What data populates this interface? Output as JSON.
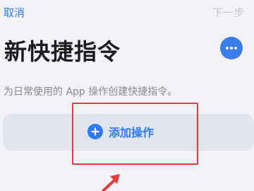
{
  "nav": {
    "cancel_label": "取消",
    "next_label": "下一步"
  },
  "header": {
    "title": "新快捷指令",
    "more_icon": "ellipsis-icon"
  },
  "description": "为日常使用的 App 操作创建快捷指令。",
  "action_card": {
    "add_label": "添加操作",
    "add_icon": "plus-circle-icon"
  },
  "annotation": {
    "highlight_color": "#e43c3c",
    "arrow_icon": "arrow-icon"
  },
  "colors": {
    "accent": "#2f7bf5",
    "background": "#f2f2f7",
    "card": "#e3e5ee"
  }
}
